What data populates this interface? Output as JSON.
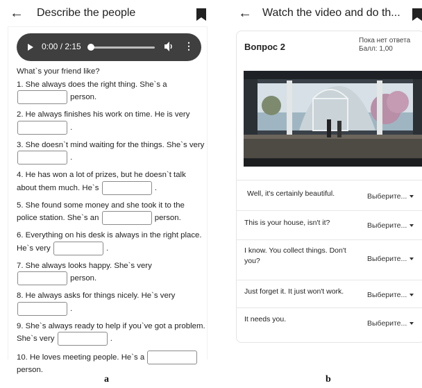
{
  "panel_a": {
    "title": "Describe the people",
    "audio": {
      "time": "0:00 / 2:15",
      "progress": 0
    },
    "intro": "What`s your friend like?",
    "questions": {
      "q1": {
        "before": "1. She always does the right thing. She`s a",
        "after": "person."
      },
      "q2": {
        "before": "2. He always finishes his work on time. He is very",
        "after": "."
      },
      "q3": {
        "before": "3. She doesn`t mind waiting for the things. She`s very",
        "after": "."
      },
      "q4": {
        "before": "4. He has won a lot of prizes, but he doesn`t talk about them much. He`s",
        "after": "."
      },
      "q5": {
        "before": "5. She found some money and she took it to the police station. She`s an",
        "after": "person."
      },
      "q6": {
        "before": "6. Everything on his desk is always in the right place. He`s very",
        "after": "."
      },
      "q7": {
        "before": "7. She always looks happy. She`s very",
        "after": "person."
      },
      "q8": {
        "before": "8. He always asks for things nicely. He`s very",
        "after": "."
      },
      "q9": {
        "before": "9. She`s always ready to help if you`ve got a problem. She`s very",
        "after": "."
      },
      "q10": {
        "before": "10. He loves meeting people. He`s a",
        "after": "person."
      }
    },
    "caption": "a"
  },
  "panel_b": {
    "title": "Watch the video and do th...",
    "question_label": "Вопрос 2",
    "status": "Пока нет ответа",
    "score": "Балл: 1,00",
    "rows": {
      "r1": {
        "text": "Well, it's certainly beautiful.",
        "select": "Выберите..."
      },
      "r2": {
        "text": "This is your house, isn't it?",
        "select": "Выберите..."
      },
      "r3": {
        "text": "I know. You collect things. Don't you?",
        "select": "Выберите..."
      },
      "r4": {
        "text": "Just forget it. It just won't work.",
        "select": "Выберите..."
      },
      "r5": {
        "text": "It needs you.",
        "select": "Выберите..."
      }
    },
    "caption": "b"
  },
  "colors": {
    "player_bg": "#3f3f3f",
    "border": "#e4e4e4",
    "text": "#222222"
  },
  "icons": [
    "back-arrow-icon",
    "bookmark-icon",
    "play-icon",
    "volume-icon",
    "more-vertical-icon",
    "caret-down-icon"
  ]
}
